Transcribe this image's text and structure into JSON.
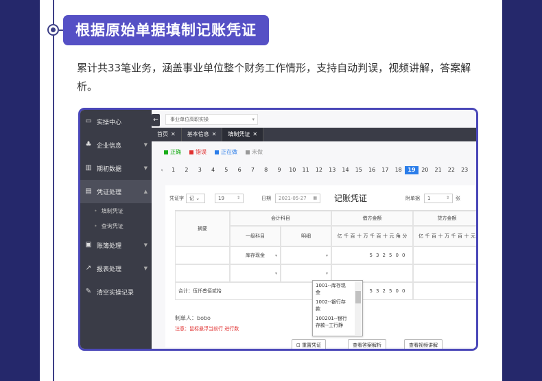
{
  "banner": "根据原始单据填制记账凭证",
  "description": "累计共33笔业务，涵盖事业单位整个财务工作情形，支持自动判误，视频讲解，答案解析。",
  "sidebar": {
    "items": [
      {
        "label": "实操中心",
        "icon": "monitor-icon"
      },
      {
        "label": "企业信息",
        "icon": "users-icon"
      },
      {
        "label": "期初数据",
        "icon": "chart-icon"
      },
      {
        "label": "凭证处理",
        "icon": "document-icon"
      },
      {
        "label": "账簿处理",
        "icon": "book-icon"
      },
      {
        "label": "报表处理",
        "icon": "trend-icon"
      },
      {
        "label": "清空实操记录",
        "icon": "clear-icon"
      }
    ],
    "subitems": [
      "填制凭证",
      "查询凭证"
    ]
  },
  "top_select": "事业单位高职实操",
  "tabs": [
    {
      "label": "首页"
    },
    {
      "label": "基本信息"
    },
    {
      "label": "填制凭证"
    }
  ],
  "legend": [
    {
      "label": "正确",
      "color": "#1aad19"
    },
    {
      "label": "错误",
      "color": "#e03030"
    },
    {
      "label": "正在做",
      "color": "#2b7de9"
    },
    {
      "label": "未做",
      "color": "#999999"
    }
  ],
  "page_numbers": [
    "1",
    "2",
    "3",
    "4",
    "5",
    "6",
    "7",
    "8",
    "9",
    "10",
    "11",
    "12",
    "13",
    "14",
    "15",
    "16",
    "17",
    "18",
    "19",
    "20",
    "21",
    "22",
    "23"
  ],
  "current_page": "19",
  "form": {
    "voucher_word_label": "凭证字",
    "voucher_word_value": "记",
    "voucher_no": "19",
    "date_label": "日期",
    "date_value": "2021-05-27",
    "title": "记账凭证",
    "attach_label": "附单据",
    "attach_value": "1",
    "attach_unit": "张",
    "col_summary": "摘要",
    "col_subject": "会计科目",
    "col_level1": "一级科目",
    "col_detail": "明细",
    "col_debit": "借方金额",
    "col_credit": "贷方金额",
    "digit_heads": [
      "亿",
      "千",
      "百",
      "十",
      "万",
      "千",
      "百",
      "十",
      "元",
      "角",
      "分"
    ],
    "credit_digit_heads": [
      "亿",
      "千",
      "百",
      "十",
      "万",
      "千",
      "百",
      "十",
      "元"
    ],
    "row1_subject": "库存现金",
    "row1_amount_digits": [
      "5",
      "3",
      "2",
      "5",
      "0",
      "0"
    ],
    "total_label": "合计：伍仟叁佰贰拾",
    "total_digits": [
      "5",
      "3",
      "2",
      "5",
      "0",
      "0"
    ],
    "maker": "制单人：bobo",
    "warning": "注意：鼠标悬浮当前行                                    进行数",
    "dropdown_options": [
      "1001--库存现金",
      "1002--银行存款",
      "100201--银行存款--工行静"
    ],
    "buttons": [
      "重置凭证",
      "查看答案解析",
      "查看视频讲解"
    ]
  }
}
